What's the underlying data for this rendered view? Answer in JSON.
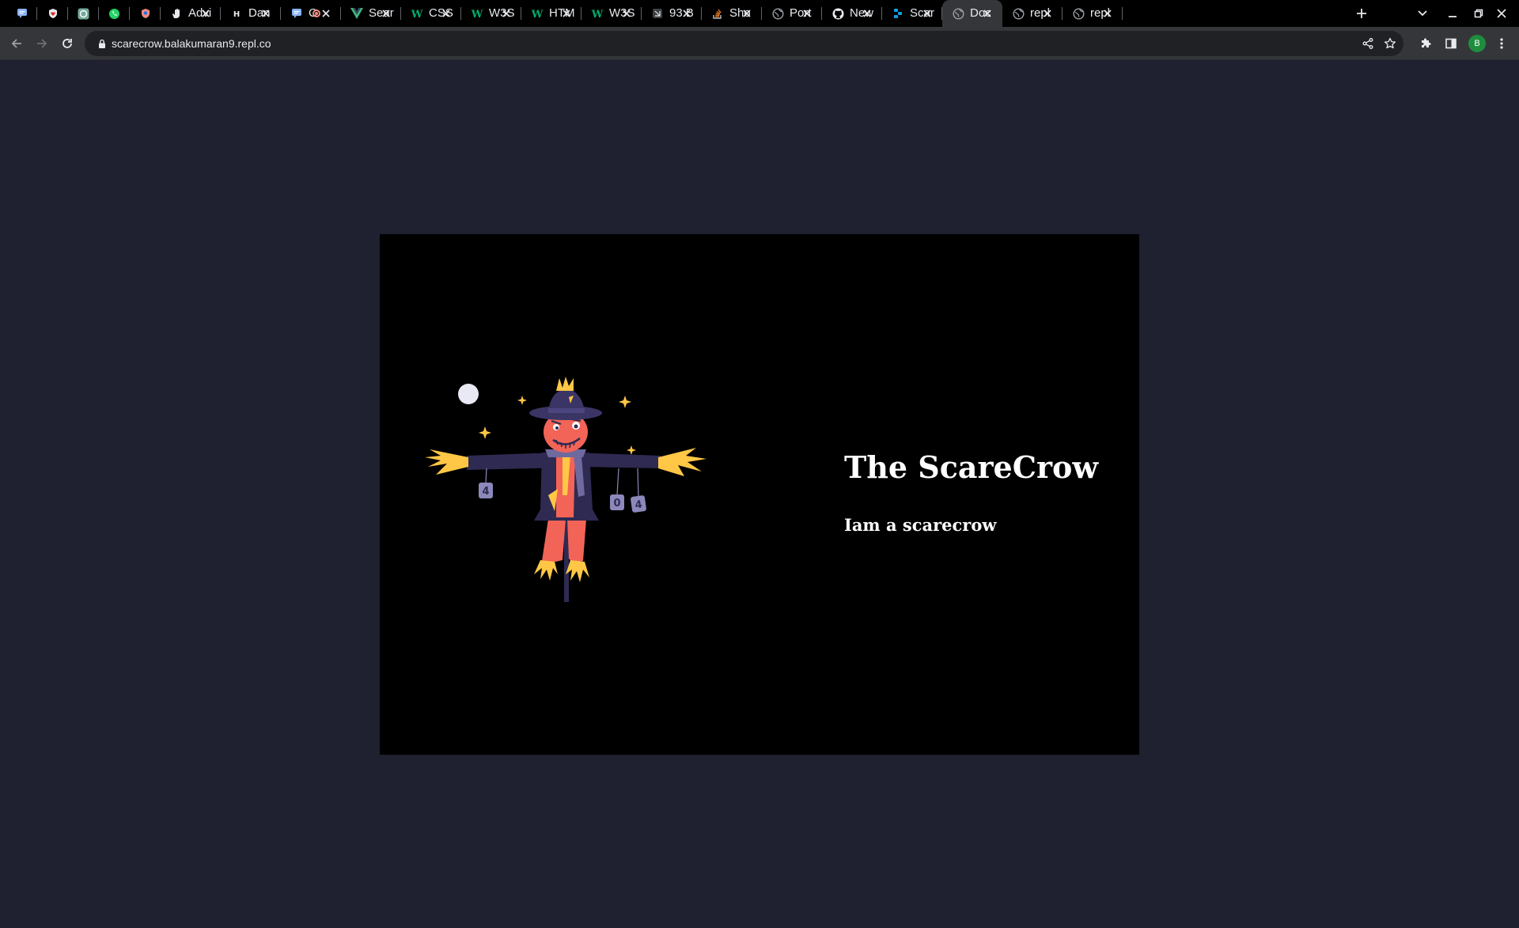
{
  "browser": {
    "tabs": [
      {
        "title": "",
        "icon": "chat-bubble-icon",
        "pinned": true
      },
      {
        "title": "",
        "icon": "shield-heart-icon",
        "pinned": true
      },
      {
        "title": "",
        "icon": "chatgpt-icon",
        "pinned": true
      },
      {
        "title": "",
        "icon": "whatsapp-icon",
        "pinned": true
      },
      {
        "title": "",
        "icon": "shield-badge-icon",
        "pinned": true
      },
      {
        "title": "Advi",
        "icon": "hand-icon"
      },
      {
        "title": "Dan",
        "icon": "hashnode-icon"
      },
      {
        "title": "C",
        "icon": "chat-bubble-icon",
        "recording": true
      },
      {
        "title": "Sear",
        "icon": "vue-icon"
      },
      {
        "title": "CSS",
        "icon": "w3schools-icon"
      },
      {
        "title": "W3S",
        "icon": "w3schools-icon"
      },
      {
        "title": "HTM",
        "icon": "w3schools-icon"
      },
      {
        "title": "W3S",
        "icon": "w3schools-icon"
      },
      {
        "title": "93 B",
        "icon": "document-icon"
      },
      {
        "title": "Sho",
        "icon": "stackoverflow-icon"
      },
      {
        "title": "Port",
        "icon": "globe-icon"
      },
      {
        "title": "New",
        "icon": "github-icon"
      },
      {
        "title": "Scar",
        "icon": "replit-icon"
      },
      {
        "title": "Doc",
        "icon": "globe-icon",
        "active": true
      },
      {
        "title": "repl",
        "icon": "globe-icon"
      },
      {
        "title": "repl",
        "icon": "globe-icon"
      }
    ],
    "url": "scarecrow.balakumaran9.repl.co",
    "profile_initial": "B"
  },
  "page": {
    "title": "The ScareCrow",
    "subtitle": "Iam a scarecrow",
    "tag_values": [
      "4",
      "0",
      "4"
    ]
  },
  "colors": {
    "page_bg": "#1f2030",
    "card_bg": "#000000",
    "hat_purple": "#3b3566",
    "straw_yellow": "#ffc745",
    "body_red": "#f26457"
  }
}
